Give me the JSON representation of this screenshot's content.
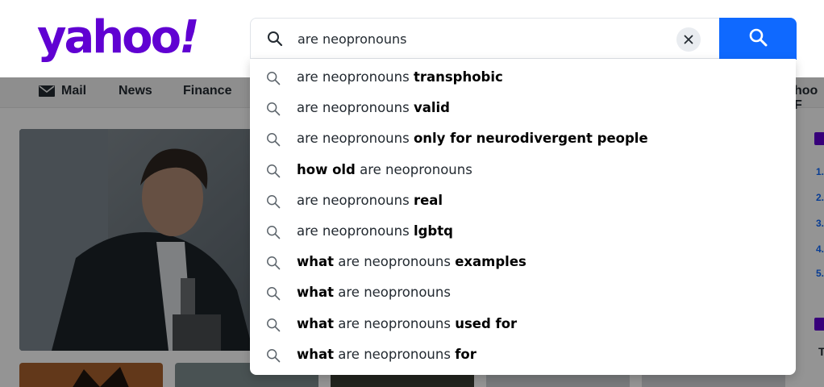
{
  "logo": {
    "text": "yahoo",
    "bang": "!"
  },
  "nav": {
    "mail": "Mail",
    "news": "News",
    "finance": "Finance",
    "right_partial": "hoo F"
  },
  "search": {
    "value": "are neopronouns",
    "placeholder": "",
    "clear_icon": "close-icon",
    "submit_icon": "search-icon"
  },
  "suggestions": [
    {
      "pre": "",
      "bold1": "",
      "mid": "are neopronouns ",
      "bold2": "transphobic"
    },
    {
      "pre": "",
      "bold1": "",
      "mid": "are neopronouns ",
      "bold2": "valid"
    },
    {
      "pre": "",
      "bold1": "",
      "mid": "are neopronouns ",
      "bold2": "only for neurodivergent people"
    },
    {
      "pre": "",
      "bold1": "how old",
      "mid": " are neopronouns",
      "bold2": ""
    },
    {
      "pre": "",
      "bold1": "",
      "mid": "are neopronouns ",
      "bold2": "real"
    },
    {
      "pre": "",
      "bold1": "",
      "mid": "are neopronouns ",
      "bold2": "lgbtq"
    },
    {
      "pre": "",
      "bold1": "what",
      "mid": " are neopronouns ",
      "bold2": "examples"
    },
    {
      "pre": "",
      "bold1": "what",
      "mid": " are neopronouns",
      "bold2": ""
    },
    {
      "pre": "",
      "bold1": "what",
      "mid": " are neopronouns ",
      "bold2": "used for"
    },
    {
      "pre": "",
      "bold1": "what",
      "mid": " are neopronouns ",
      "bold2": "for"
    }
  ],
  "sidebar_numbers": [
    "1.",
    "2.",
    "3.",
    "4.",
    "5."
  ],
  "sidebar_letter": "T",
  "colors": {
    "brand": "#6001d2",
    "search_button": "#0f69ff",
    "overlay": "rgba(0,0,0,0.42)"
  }
}
